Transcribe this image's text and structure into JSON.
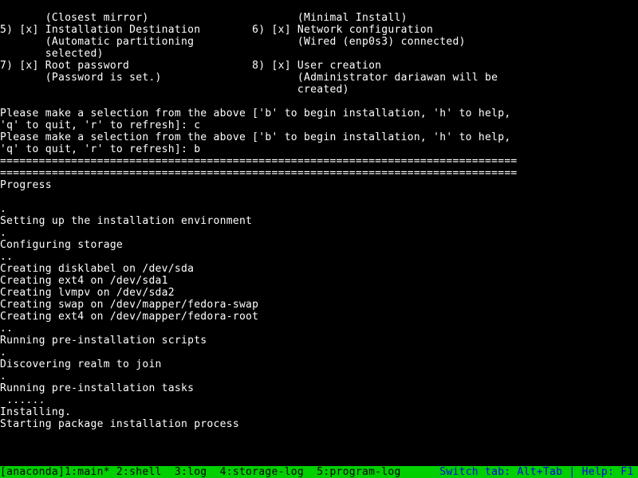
{
  "menu": {
    "item4_sub": "       (Closest mirror)                       (Minimal Install)",
    "item5": "5) [x] Installation Destination        6) [x] Network configuration",
    "item5_sub1": "       (Automatic partitioning                (Wired (enp0s3) connected)",
    "item5_sub2": "       selected)",
    "item7": "7) [x] Root password                   8) [x] User creation",
    "item7_sub1": "       (Password is set.)                     (Administrator dariawan will be",
    "item7_sub2": "                                              created)"
  },
  "prompt1a": "Please make a selection from the above ['b' to begin installation, 'h' to help,",
  "prompt1b": "'q' to quit, 'r' to refresh]: c",
  "prompt2a": "Please make a selection from the above ['b' to begin installation, 'h' to help,",
  "prompt2b": "'q' to quit, 'r' to refresh]: b",
  "divider": "================================================================================",
  "progress_header": "Progress",
  "progress": {
    "dot1": ".",
    "setup_env": "Setting up the installation environment",
    "dot2": ".",
    "config_storage": "Configuring storage",
    "dots3": "..",
    "disklabel": "Creating disklabel on /dev/sda",
    "ext4_sda1": "Creating ext4 on /dev/sda1",
    "lvmpv": "Creating lvmpv on /dev/sda2",
    "swap": "Creating swap on /dev/mapper/fedora-swap",
    "ext4_root": "Creating ext4 on /dev/mapper/fedora-root",
    "dots4": "..",
    "preinstall_scripts": "Running pre-installation scripts",
    "dot5": ".",
    "discovering": "Discovering realm to join",
    "dot6": ".",
    "preinstall_tasks": "Running pre-installation tasks",
    "dots7": " ......",
    "installing": "Installing.",
    "starting_pkg": "Starting package installation process"
  },
  "status": {
    "left": "[anaconda]1:main* 2:shell  3:log  4:storage-log  5:program-log",
    "right": "Switch tab: Alt+Tab | Help: F1 "
  }
}
